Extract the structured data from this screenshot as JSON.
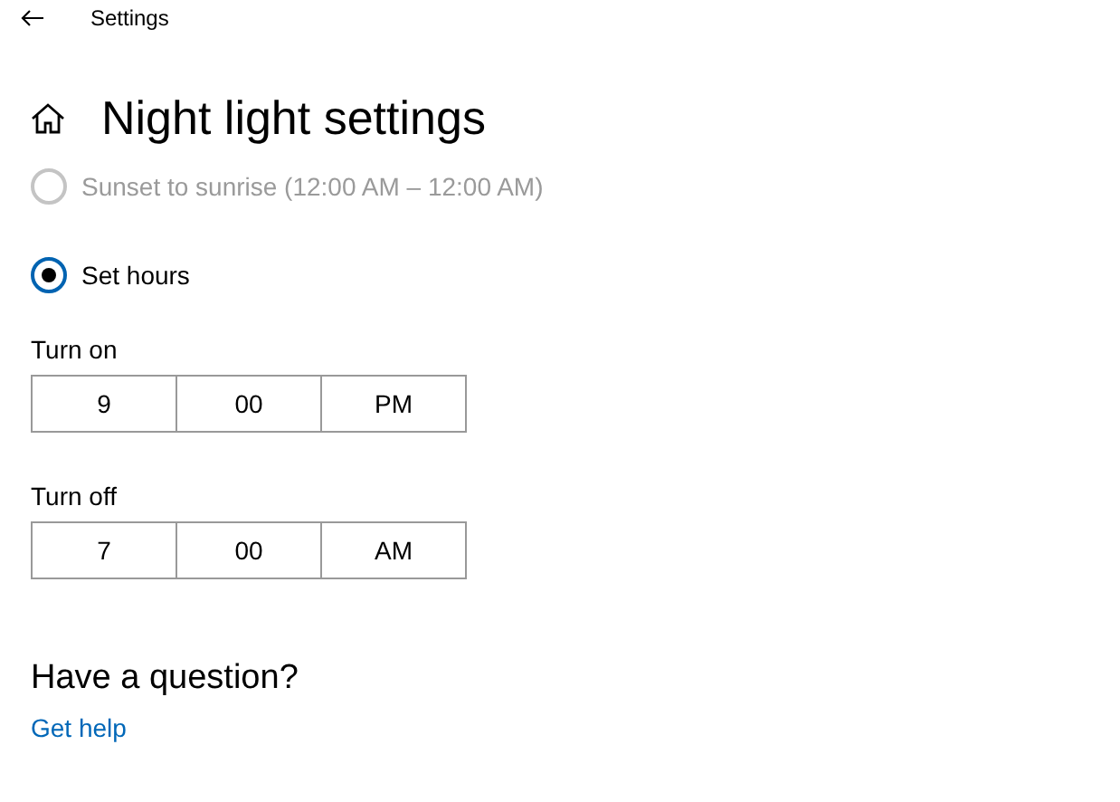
{
  "window": {
    "title": "Settings"
  },
  "page": {
    "heading": "Night light settings"
  },
  "schedule_options": [
    {
      "label": "Sunset to sunrise (12:00 AM – 12:00 AM)",
      "selected": false,
      "disabled": true
    },
    {
      "label": "Set hours",
      "selected": true,
      "disabled": false
    }
  ],
  "time_pickers": [
    {
      "label": "Turn on",
      "segments": [
        "9",
        "00",
        "PM"
      ]
    },
    {
      "label": "Turn off",
      "segments": [
        "7",
        "00",
        "AM"
      ]
    }
  ],
  "help": {
    "heading": "Have a question?",
    "link": "Get help"
  }
}
